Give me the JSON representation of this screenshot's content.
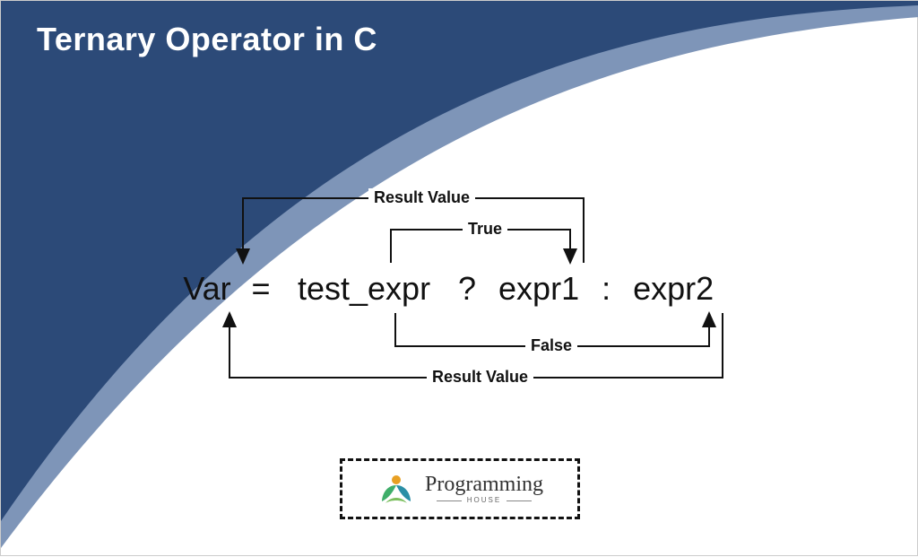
{
  "title": "Ternary Operator in C",
  "expression": {
    "var": "Var",
    "eq": "=",
    "test": "test_expr",
    "qmark": "?",
    "expr1": "expr1",
    "colon": ":",
    "expr2": "expr2"
  },
  "labels": {
    "result_top": "Result Value",
    "true": "True",
    "false": "False",
    "result_bottom": "Result Value"
  },
  "logo": {
    "name": "Programming",
    "subtitle": "HOUSE"
  },
  "colors": {
    "curve_dark": "#2C4A78",
    "curve_light": "#7E95B8"
  }
}
